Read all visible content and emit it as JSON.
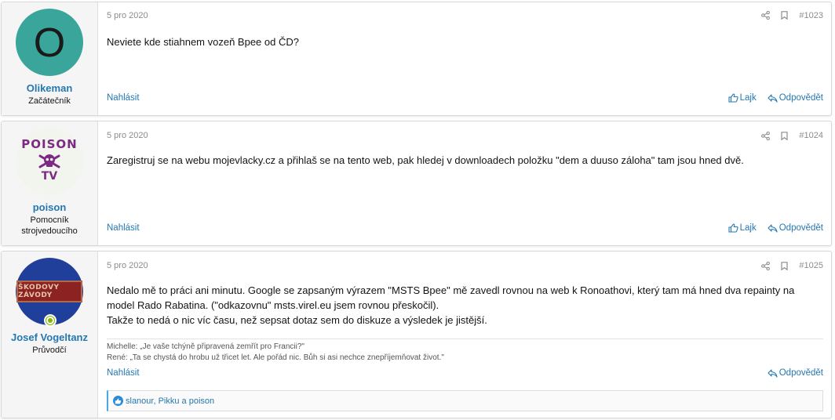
{
  "colors": {
    "link": "#2577b1",
    "muted": "#8c8c8c",
    "online": "#7fb900",
    "like": "#2b8bd8"
  },
  "actions": {
    "report_label": "Nahlásit",
    "like_label": "Lajk",
    "reply_label": "Odpovědět"
  },
  "posts": [
    {
      "avatar_letter": "O",
      "username": "Olikeman",
      "user_title": "Začátečník",
      "date": "5 pro 2020",
      "number": "#1023",
      "body": [
        "Neviete kde stiahnem vozeň Bpee od ČD?"
      ]
    },
    {
      "avatar_text_top": "POISON",
      "avatar_text_bottom": "TV",
      "username": "poison",
      "user_title": "Pomocník strojvedoucího",
      "date": "5 pro 2020",
      "number": "#1024",
      "body": [
        "Zaregistruj se na webu mojevlacky.cz a přihlaš se na tento web, pak hledej v downloadech položku \"dem a duuso záloha\" tam jsou hned dvě."
      ]
    },
    {
      "avatar_plate_text": "ŠKODOVY ZÁVODY",
      "username": "Josef Vogeltanz",
      "user_title": "Průvodčí",
      "date": "5 pro 2020",
      "number": "#1025",
      "body": [
        "Nedalo mě to práci ani minutu. Google se zapsaným výrazem \"MSTS Bpee\" mě zavedl rovnou na web k Ronoathovi, který tam má hned dva repainty na model Rado Rabatina. (\"odkazovnu\" msts.virel.eu jsem rovnou přeskočil).",
        "Takže to nedá o nic víc času, než sepsat dotaz sem do diskuze a výsledek je jistější."
      ],
      "signature": [
        "Michelle: „Je vaše tchýně připravená zemřít pro Francii?\"",
        "René: „Ta se chystá do hrobu už třicet let. Ale pořád nic. Bůh si asi nechce znepříjemňovat život.\""
      ],
      "reactions": "slanour, Pikku a poison"
    }
  ]
}
